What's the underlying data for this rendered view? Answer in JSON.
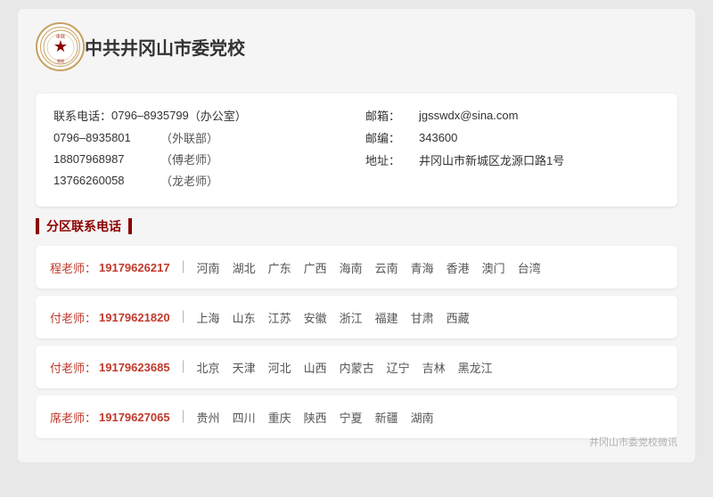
{
  "header": {
    "org_name": "中共井冈山市委党校",
    "logo_symbol": "★"
  },
  "contact_info": {
    "phones_label": "联系电话：",
    "phones": [
      {
        "number": "0796–8935799",
        "note": "（办公室）"
      },
      {
        "number": "0796–8935801",
        "note": "（外联部）"
      },
      {
        "number": "18807968987",
        "note": "（傅老师）"
      },
      {
        "number": "13766260058",
        "note": "（龙老师）"
      }
    ],
    "email_label": "邮箱：",
    "email": "jgsswdx@sina.com",
    "postcode_label": "邮编：",
    "postcode": "343600",
    "address_label": "地址：",
    "address": "井冈山市新城区龙源口路1号"
  },
  "section_title": "分区联系电话",
  "teachers": [
    {
      "name": "程老师：",
      "phone": "19179626217",
      "regions": [
        "河南",
        "湖北",
        "广东",
        "广西",
        "海南",
        "云南",
        "青海",
        "香港",
        "澳门",
        "台湾"
      ]
    },
    {
      "name": "付老师：",
      "phone": "19179621820",
      "regions": [
        "上海",
        "山东",
        "江苏",
        "安徽",
        "浙江",
        "福建",
        "甘肃",
        "西藏"
      ]
    },
    {
      "name": "付老师：",
      "phone": "19179623685",
      "regions": [
        "北京",
        "天津",
        "河北",
        "山西",
        "内蒙古",
        "辽宁",
        "吉林",
        "黑龙江"
      ]
    },
    {
      "name": "席老师：",
      "phone": "19179627065",
      "regions": [
        "贵州",
        "四川",
        "重庆",
        "陕西",
        "宁夏",
        "新疆",
        "湖南"
      ]
    }
  ],
  "watermark": "井冈山市委党校微讯"
}
